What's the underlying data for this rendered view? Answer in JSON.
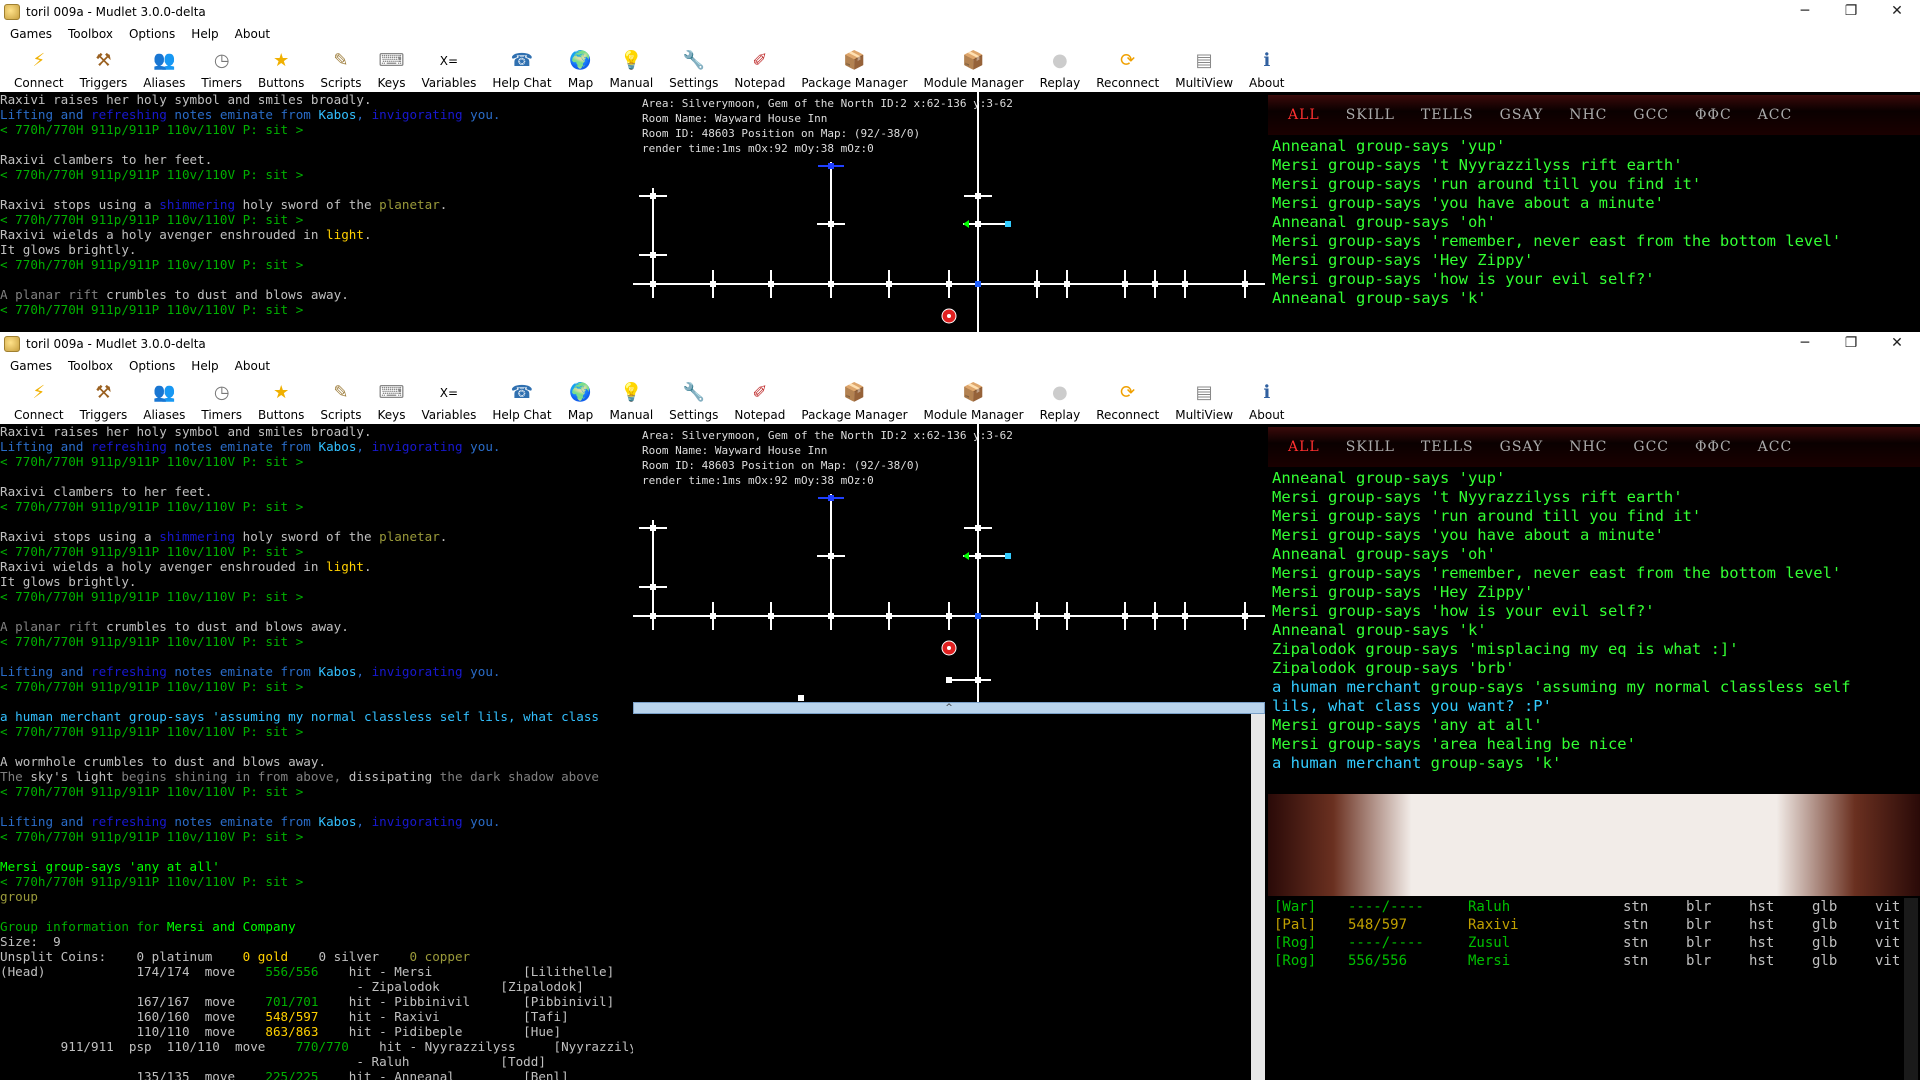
{
  "window_title": "toril 009a - Mudlet 3.0.0-delta",
  "window_controls": {
    "minimize": "─",
    "restore": "❐",
    "close": "✕"
  },
  "menu": [
    "Games",
    "Toolbox",
    "Options",
    "Help",
    "About"
  ],
  "toolbar": [
    {
      "label": "Connect",
      "icon": "connect-icon",
      "glyph": "⚡",
      "color": "#f0b000"
    },
    {
      "label": "Triggers",
      "icon": "triggers-icon",
      "glyph": "⚒",
      "color": "#9a6020"
    },
    {
      "label": "Aliases",
      "icon": "aliases-icon",
      "glyph": "👥",
      "color": "#a06040"
    },
    {
      "label": "Timers",
      "icon": "timers-icon",
      "glyph": "◷",
      "color": "#777"
    },
    {
      "label": "Buttons",
      "icon": "buttons-icon",
      "glyph": "★",
      "color": "#f0b000"
    },
    {
      "label": "Scripts",
      "icon": "scripts-icon",
      "glyph": "✎",
      "color": "#a08040"
    },
    {
      "label": "Keys",
      "icon": "keys-icon",
      "glyph": "⌨",
      "color": "#888"
    },
    {
      "label": "Variables",
      "icon": "variables-icon",
      "glyph": "X=",
      "color": "#000"
    },
    {
      "label": "Help Chat",
      "icon": "help-chat-icon",
      "glyph": "☎",
      "color": "#3070b0"
    },
    {
      "label": "Map",
      "icon": "map-icon",
      "glyph": "🌍",
      "color": "#2050c0"
    },
    {
      "label": "Manual",
      "icon": "manual-icon",
      "glyph": "💡",
      "color": "#f0c000"
    },
    {
      "label": "Settings",
      "icon": "settings-icon",
      "glyph": "🔧",
      "color": "#888"
    },
    {
      "label": "Notepad",
      "icon": "notepad-icon",
      "glyph": "✐",
      "color": "#c03030"
    },
    {
      "label": "Package Manager",
      "icon": "package-manager-icon",
      "glyph": "📦",
      "color": "#a07040"
    },
    {
      "label": "Module Manager",
      "icon": "module-manager-icon",
      "glyph": "📦",
      "color": "#a07040"
    },
    {
      "label": "Replay",
      "icon": "replay-icon",
      "glyph": "●",
      "color": "#ccc"
    },
    {
      "label": "Reconnect",
      "icon": "reconnect-icon",
      "glyph": "⟳",
      "color": "#f0a000"
    },
    {
      "label": "MultiView",
      "icon": "multiview-icon",
      "glyph": "▤",
      "color": "#888"
    },
    {
      "label": "About",
      "icon": "about-icon",
      "glyph": "ℹ",
      "color": "#3060a0"
    }
  ],
  "map_info": [
    "Area: Silverymoon, Gem of the North ID:2 x:62-136 y:3-62",
    "Room Name: Wayward House Inn",
    "Room ID: 48603 Position on Map: (92/-38/0)",
    "render time:1ms mOx:92 mOy:38 mOz:0"
  ],
  "chat_tabs": [
    "ALL",
    "SKILL",
    "TELLS",
    "GSAY",
    "NHC",
    "GCC",
    "ΦΦC",
    "ACC"
  ],
  "chat_lines_1": [
    "Anneanal group-says 'yup'",
    "Mersi group-says 't Nyyrazzilyss rift earth'",
    "Mersi group-says 'run around till you find it'",
    "Mersi group-says 'you have about a minute'",
    "Anneanal group-says 'oh'",
    "Mersi group-says 'remember, never east from the bottom level'",
    "",
    "Mersi group-says 'Hey Zippy'",
    "Mersi group-says 'how is your evil self?'",
    "Anneanal group-says 'k'"
  ],
  "chat_lines_2": [
    "Anneanal group-says 'yup'",
    "Mersi group-says 't Nyyrazzilyss rift earth'",
    "Mersi group-says 'run around till you find it'",
    "Mersi group-says 'you have about a minute'",
    "Anneanal group-says 'oh'",
    "Mersi group-says 'remember, never east from the bottom level'",
    "",
    "Mersi group-says 'Hey Zippy'",
    "Mersi group-says 'how is your evil self?'",
    "Anneanal group-says 'k'",
    "Zipalodok group-says 'misplacing my eq is what :]'",
    "Zipalodok group-says 'brb'",
    "a human merchant| group-says 'assuming my normal classless self",
    "lils, what class you want? :P'",
    "Mersi group-says 'any at all'",
    "Mersi group-says 'area healing be nice'",
    "a human merchant| group-says 'k'"
  ],
  "group_status": [
    {
      "cls": "[War]",
      "hp": "----/----",
      "name": "Raluh",
      "color": "#00c000"
    },
    {
      "cls": "[Pal]",
      "hp": "548/597",
      "name": "Raxivi",
      "color": "#c0a000"
    },
    {
      "cls": "[Rog]",
      "hp": "----/----",
      "name": "Zusul",
      "color": "#00c000"
    },
    {
      "cls": "[Rog]",
      "hp": "556/556",
      "name": "Mersi",
      "color": "#00c000"
    }
  ],
  "status_cols": [
    "stn",
    "blr",
    "hst",
    "glb",
    "vit"
  ],
  "prompt": "< 770h/770H 911p/911P 110v/110V P: sit >",
  "resize_glyph": "^"
}
